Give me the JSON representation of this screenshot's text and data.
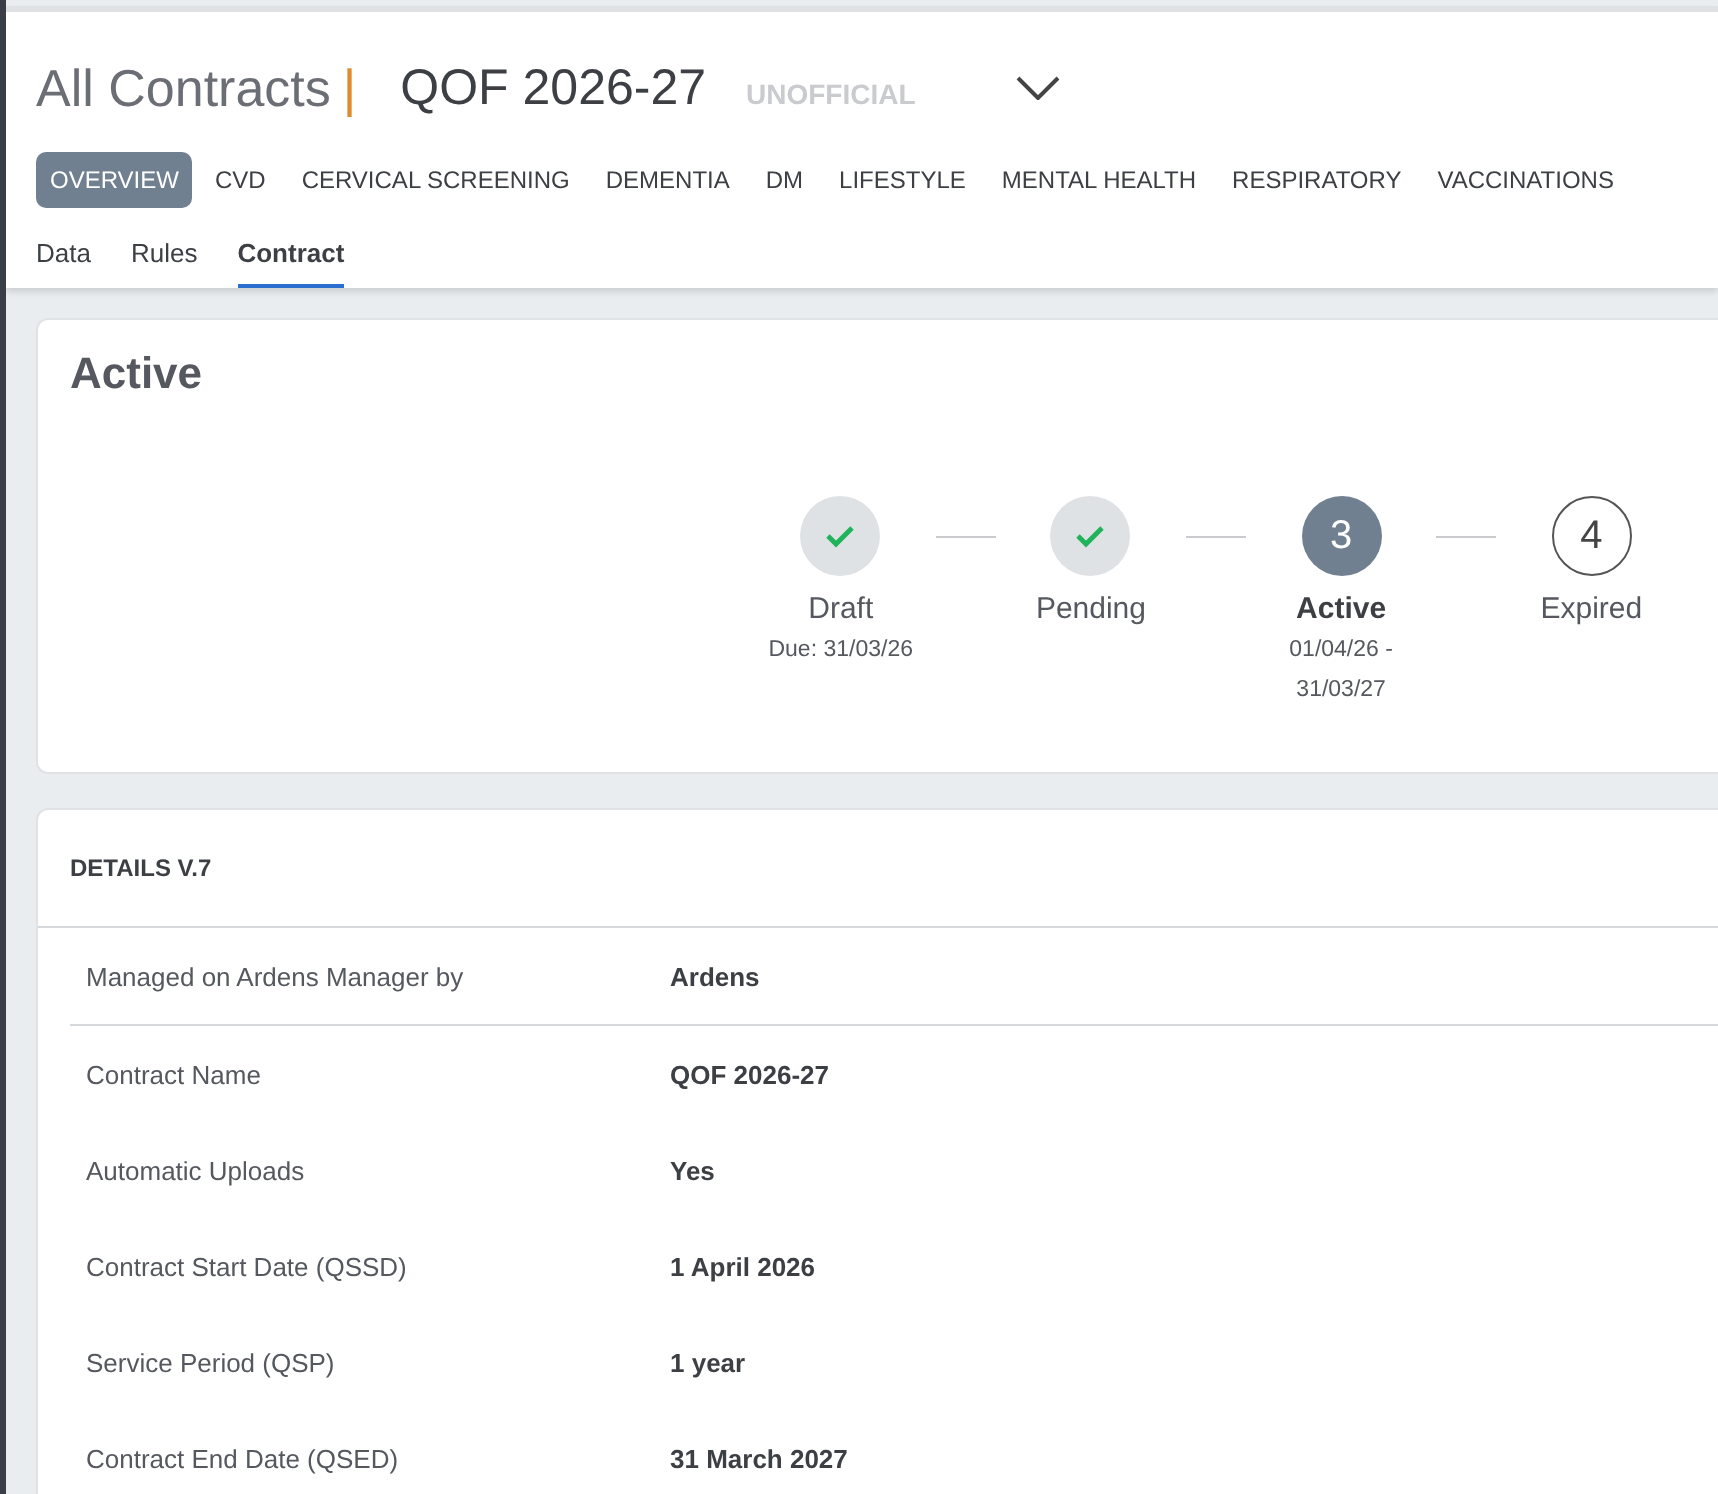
{
  "header": {
    "breadcrumb": "All Contracts",
    "separator": "|",
    "title": "QOF 2026-27",
    "badge": "UNOFFICIAL"
  },
  "tabs": [
    {
      "label": "OVERVIEW",
      "selected": true
    },
    {
      "label": "CVD",
      "selected": false
    },
    {
      "label": "CERVICAL SCREENING",
      "selected": false
    },
    {
      "label": "DEMENTIA",
      "selected": false
    },
    {
      "label": "DM",
      "selected": false
    },
    {
      "label": "LIFESTYLE",
      "selected": false
    },
    {
      "label": "MENTAL HEALTH",
      "selected": false
    },
    {
      "label": "RESPIRATORY",
      "selected": false
    },
    {
      "label": "VACCINATIONS",
      "selected": false
    }
  ],
  "subtabs": [
    {
      "label": "Data",
      "selected": false
    },
    {
      "label": "Rules",
      "selected": false
    },
    {
      "label": "Contract",
      "selected": true
    }
  ],
  "status_card": {
    "title": "Active",
    "steps": [
      {
        "kind": "done",
        "label": "Draft",
        "sublabel": "Due: 31/03/26"
      },
      {
        "kind": "done",
        "label": "Pending"
      },
      {
        "kind": "current",
        "number": "3",
        "label": "Active",
        "sublabel": "01/04/26 - 31/03/27"
      },
      {
        "kind": "upcoming",
        "number": "4",
        "label": "Expired"
      }
    ]
  },
  "details": {
    "title": "DETAILS V.7",
    "rows": [
      {
        "label": "Managed on Ardens Manager by",
        "value": "Ardens"
      },
      {
        "label": "Contract Name",
        "value": "QOF 2026-27"
      },
      {
        "label": "Automatic Uploads",
        "value": "Yes"
      },
      {
        "label": "Contract Start Date (QSSD)",
        "value": "1 April 2026"
      },
      {
        "label": "Service Period (QSP)",
        "value": "1 year"
      },
      {
        "label": "Contract End Date (QSED)",
        "value": "31 March 2027"
      }
    ]
  }
}
